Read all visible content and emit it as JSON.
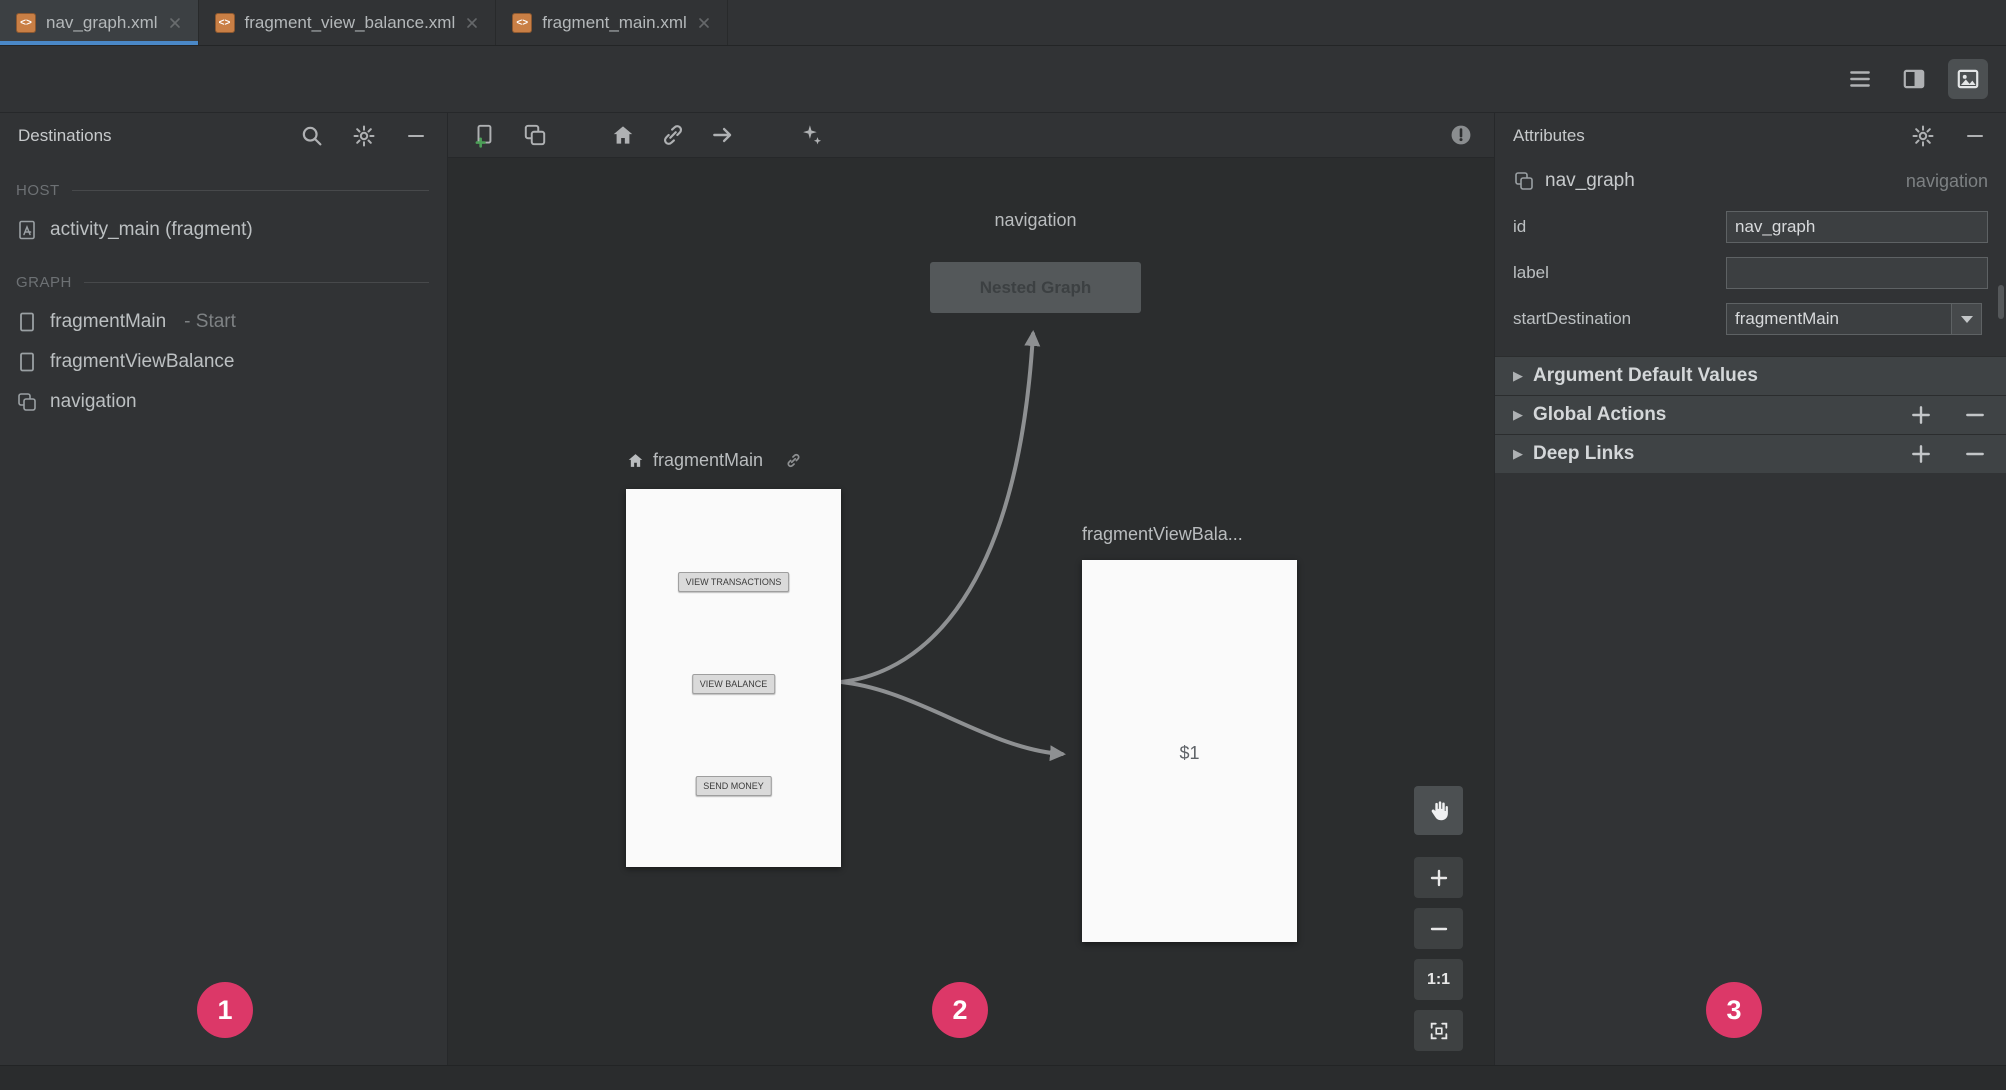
{
  "tabs": [
    {
      "label": "nav_graph.xml",
      "active": true
    },
    {
      "label": "fragment_view_balance.xml",
      "active": false
    },
    {
      "label": "fragment_main.xml",
      "active": false
    }
  ],
  "destinations": {
    "title": "Destinations",
    "host_label": "HOST",
    "graph_label": "GRAPH",
    "host_items": [
      {
        "label": "activity_main (fragment)",
        "icon": "activity-icon"
      }
    ],
    "graph_items": [
      {
        "label": "fragmentMain",
        "suffix": "- Start",
        "icon": "fragment-icon"
      },
      {
        "label": "fragmentViewBalance",
        "suffix": "",
        "icon": "fragment-icon"
      },
      {
        "label": "navigation",
        "suffix": "",
        "icon": "nested-graph-icon"
      }
    ]
  },
  "editor": {
    "nested_graph_label": "navigation",
    "nested_graph_button": "Nested Graph",
    "fragment_main": {
      "label": "fragmentMain",
      "buttons": [
        "VIEW TRANSACTIONS",
        "VIEW BALANCE",
        "SEND MONEY"
      ]
    },
    "fragment_view_balance": {
      "label": "fragmentViewBala...",
      "content": "$1"
    },
    "zoom": {
      "label": "1:1"
    }
  },
  "attributes": {
    "title": "Attributes",
    "component": {
      "name": "nav_graph",
      "type": "navigation"
    },
    "fields": [
      {
        "label": "id",
        "value": "nav_graph"
      },
      {
        "label": "label",
        "value": ""
      },
      {
        "label": "startDestination",
        "value": "fragmentMain"
      }
    ],
    "sections": [
      {
        "label": "Argument Default Values"
      },
      {
        "label": "Global Actions"
      },
      {
        "label": "Deep Links"
      }
    ]
  },
  "annotations": {
    "color": "#dc3868",
    "items": [
      "1",
      "2",
      "3"
    ]
  },
  "colors": {
    "accent_blue": "#4a88c7",
    "add_green": "#4c9e57",
    "arrow_gray": "#8e9092"
  }
}
